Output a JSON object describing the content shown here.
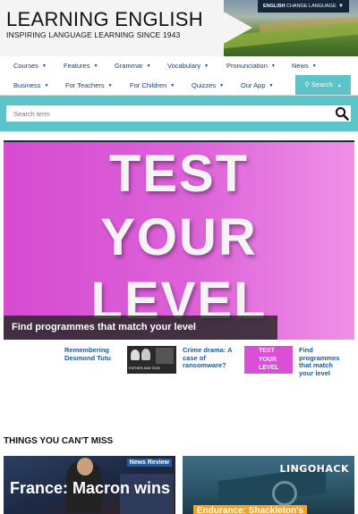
{
  "header": {
    "title": "LEARNING ENGLISH",
    "subtitle": "INSPIRING LANGUAGE LEARNING SINCE 1943",
    "lang_bold": "ENGLISH",
    "lang_rest": "CHANGE LANGUAGE"
  },
  "nav": {
    "row1": [
      "Courses",
      "Features",
      "Grammar",
      "Vocabulary",
      "Pronunciation",
      "News"
    ],
    "row2": [
      "Business",
      "For Teachers",
      "For Children",
      "Quizzes",
      "Our App"
    ],
    "search_label": "Search"
  },
  "search": {
    "placeholder": "Search term"
  },
  "hero": {
    "line1": "TEST",
    "line2": "YOUR",
    "line3": "LEVEL",
    "caption": "Find programmes that match your level"
  },
  "thumbs": {
    "t1": "Remembering Desmond Tutu",
    "t2_img_text": "FATHER AND SON",
    "t2": "Crime drama: A case of ransomware?",
    "t3_img": "TEST YOUR LEVEL",
    "t3": "Find programmes that match your level"
  },
  "section": {
    "title": "THINGS YOU CAN'T MISS"
  },
  "cards": {
    "c1_badge": "News Review",
    "c1_title": "France: Macron wins",
    "c2_brand": "LINGOHACK",
    "c2_banner": "Endurance: Shackleton's"
  }
}
